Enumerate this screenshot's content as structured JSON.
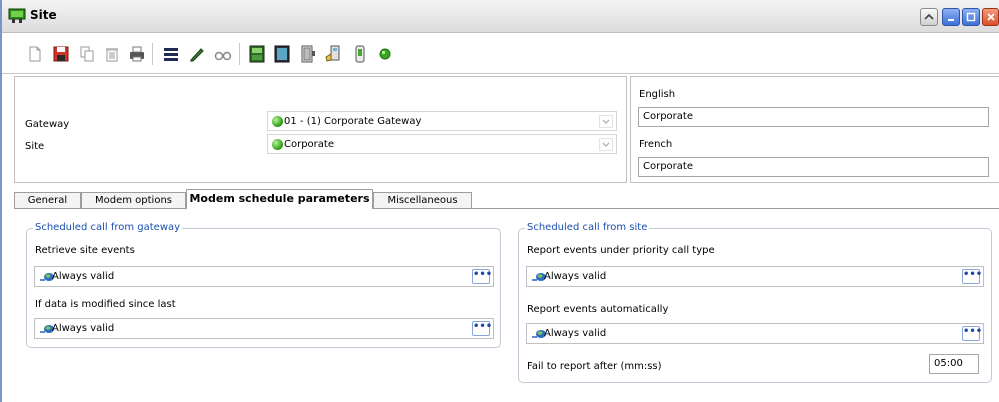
{
  "window": {
    "title": "Site"
  },
  "toolbar": {
    "buttons": [
      {
        "name": "new-icon"
      },
      {
        "name": "save-icon"
      },
      {
        "name": "copy-icon"
      },
      {
        "name": "delete-icon"
      },
      {
        "name": "print-icon"
      },
      {
        "name": "list-icon"
      },
      {
        "name": "edit-icon"
      },
      {
        "name": "find-icon"
      },
      {
        "name": "controller-icon"
      },
      {
        "name": "panel-icon"
      },
      {
        "name": "door-icon"
      },
      {
        "name": "hand-device-icon"
      },
      {
        "name": "reader-icon"
      },
      {
        "name": "status-icon"
      }
    ]
  },
  "form": {
    "gateway_label": "Gateway",
    "gateway_value": "01 - (1)  Corporate Gateway",
    "site_label": "Site",
    "site_value": "Corporate",
    "english_label": "English",
    "english_value": "Corporate",
    "french_label": "French",
    "french_value": "Corporate"
  },
  "tabs": [
    {
      "label": "General"
    },
    {
      "label": "Modem options"
    },
    {
      "label": "Modem schedule parameters",
      "active": true
    },
    {
      "label": "Miscellaneous"
    }
  ],
  "gateway_group": {
    "title": "Scheduled call from gateway",
    "retrieve_label": "Retrieve site events",
    "retrieve_value": "Always valid",
    "modified_label": "If data is modified since last",
    "modified_value": "Always valid"
  },
  "site_group": {
    "title": "Scheduled call from site",
    "priority_label": "Report events under priority call type",
    "priority_value": "Always valid",
    "auto_label": "Report events automatically",
    "auto_value": "Always valid",
    "fail_label": "Fail to report after (mm:ss)",
    "fail_value": "05:00"
  },
  "ellipsis_label": "•••",
  "colors": {
    "group_title": "#1a4fb0",
    "active_dot": "#3aa520"
  }
}
